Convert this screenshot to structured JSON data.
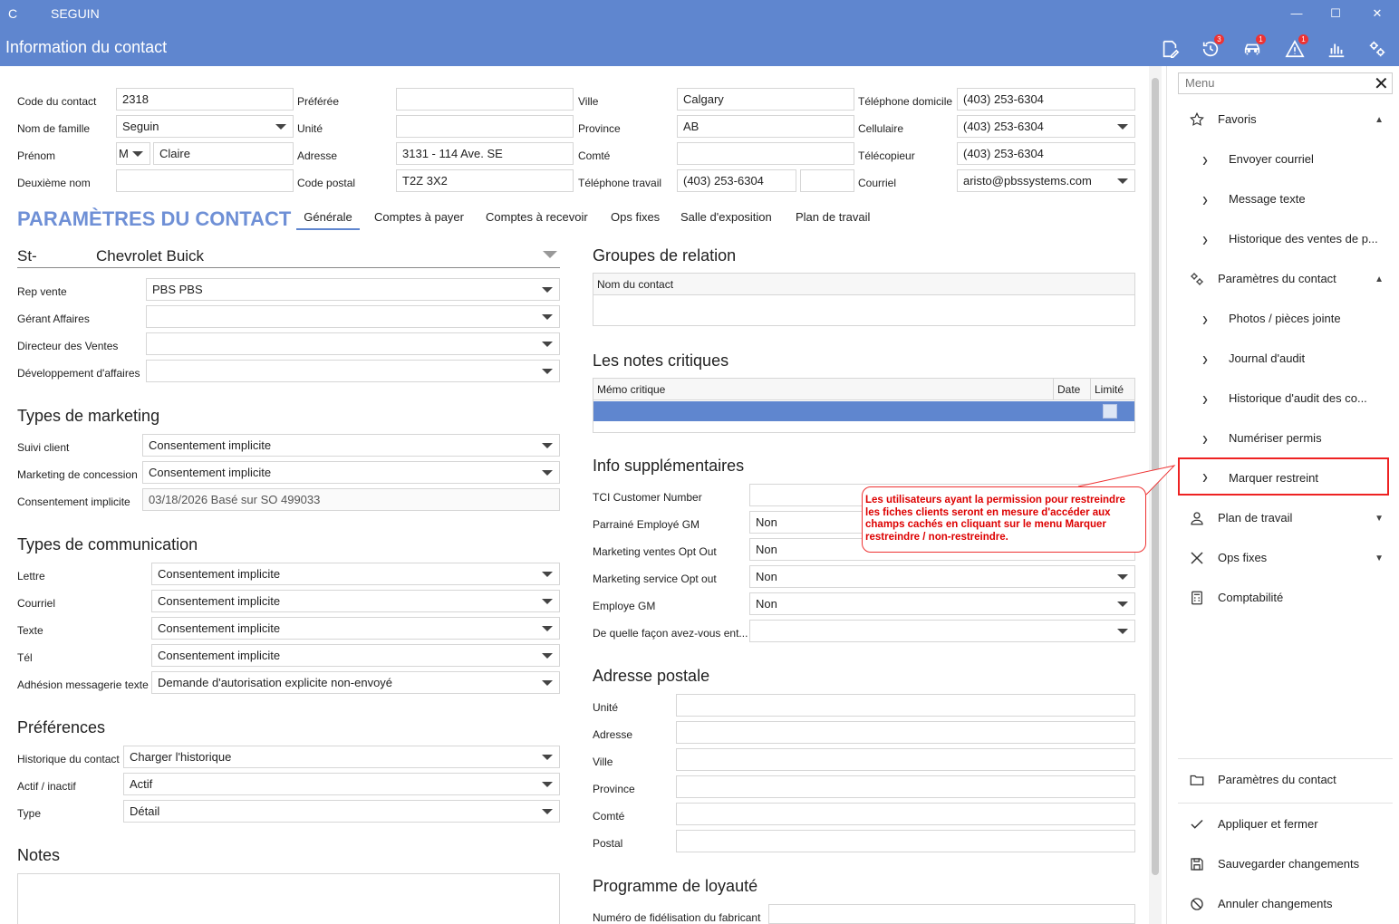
{
  "window": {
    "app_letter": "C",
    "title": "SEGUIN",
    "page_title": "Information du contact",
    "badges": {
      "history": "3",
      "car": "1",
      "alert": "1"
    },
    "controls": {
      "minimize": "—",
      "maximize": "☐",
      "close": "✕"
    }
  },
  "contact": {
    "code_label": "Code du contact",
    "code_value": "2318",
    "nom_label": "Nom de famille",
    "nom_value": "Seguin",
    "prenom_label": "Prénom",
    "prenom_title": "M",
    "prenom_value": "Claire",
    "deuxieme_label": "Deuxième nom",
    "deuxieme_value": "",
    "preferee_label": "Préférée",
    "preferee_value": "",
    "unite_label": "Unité",
    "unite_value": "",
    "adresse_label": "Adresse",
    "adresse_value": "3131 - 114 Ave. SE",
    "code_postal_label": "Code postal",
    "code_postal_value": "T2Z 3X2",
    "ville_label": "Ville",
    "ville_value": "Calgary",
    "province_label": "Province",
    "province_value": "AB",
    "comte_label": "Comté",
    "comte_value": "",
    "tel_travail_label": "Téléphone travail",
    "tel_travail_value": "(403) 253-6304",
    "tel_travail_ext": "",
    "tel_domicile_label": "Téléphone domicile",
    "tel_domicile_value": "(403) 253-6304",
    "cellulaire_label": "Cellulaire",
    "cellulaire_value": "(403) 253-6304",
    "telecopieur_label": "Télécopieur",
    "telecopieur_value": "(403) 253-6304",
    "courriel_label": "Courriel",
    "courriel_value": "aristo@pbssystems.com"
  },
  "params": {
    "title": "PARAMÈTRES DU CONTACT",
    "tabs": [
      "Générale",
      "Comptes à payer",
      "Comptes à recevoir",
      "Ops fixes",
      "Salle d'exposition",
      "Plan de travail"
    ]
  },
  "dealer": {
    "prefix": "St-",
    "name": "Chevrolet Buick",
    "rep_vente_label": "Rep vente",
    "rep_vente_value": "PBS PBS",
    "gerant_label": "Gérant Affaires",
    "gerant_value": "",
    "directeur_label": "Directeur des Ventes",
    "directeur_value": "",
    "developpement_label": "Développement d'affaires",
    "developpement_value": ""
  },
  "marketing": {
    "title": "Types de marketing",
    "suivi_label": "Suivi client",
    "suivi_value": "Consentement implicite",
    "concession_label": "Marketing de concession",
    "concession_value": "Consentement implicite",
    "implicite_label": "Consentement implicite",
    "implicite_value": "03/18/2026 Basé sur SO 499033"
  },
  "communication": {
    "title": "Types de communication",
    "lettre_label": "Lettre",
    "lettre_value": "Consentement implicite",
    "courriel_label": "Courriel",
    "courriel_value": "Consentement implicite",
    "texte_label": "Texte",
    "texte_value": "Consentement implicite",
    "tel_label": "Tél",
    "tel_value": "Consentement implicite",
    "adhesion_label": "Adhésion messagerie texte",
    "adhesion_value": "Demande d'autorisation explicite non-envoyé"
  },
  "preferences": {
    "title": "Préférences",
    "historique_label": "Historique du contact",
    "historique_value": "Charger l'historique",
    "actif_label": "Actif / inactif",
    "actif_value": "Actif",
    "type_label": "Type",
    "type_value": "Détail"
  },
  "notes": {
    "title": "Notes",
    "value": ""
  },
  "groupes": {
    "title": "Groupes de relation",
    "col": "Nom du contact"
  },
  "notes_critiques": {
    "title": "Les notes critiques",
    "col_memo": "Mémo critique",
    "col_date": "Date",
    "col_limite": "Limité"
  },
  "info_supp": {
    "title": "Info supplémentaires",
    "tci_label": "TCI Customer Number",
    "tci_value": "",
    "parraine_label": "Parrainé Employé GM",
    "parraine_value": "Non",
    "mkt_ventes_label": "Marketing ventes Opt Out",
    "mkt_ventes_value": "Non",
    "mkt_service_label": "Marketing service Opt out",
    "mkt_service_value": "Non",
    "employe_label": "Employe GM",
    "employe_value": "Non",
    "facon_label": "De quelle façon avez-vous ent...",
    "facon_value": ""
  },
  "adresse_postale": {
    "title": "Adresse postale",
    "unite_label": "Unité",
    "adresse_label": "Adresse",
    "ville_label": "Ville",
    "province_label": "Province",
    "comte_label": "Comté",
    "postal_label": "Postal"
  },
  "loyaute": {
    "title": "Programme de loyauté",
    "numero_label": "Numéro de fidélisation du fabricant",
    "numero_value": ""
  },
  "callout": {
    "text": "Les utilisateurs ayant la permission pour restreindre les fiches clients seront en mesure d'accéder aux champs cachés en cliquant sur le menu Marquer restreindre / non-restreindre."
  },
  "menu": {
    "search_placeholder": "Menu",
    "close": "✕",
    "favoris": "Favoris",
    "envoyer": "Envoyer courriel",
    "message": "Message texte",
    "historique_ventes": "Historique des ventes de p...",
    "params_contact": "Paramètres du contact",
    "photos": "Photos / pièces jointe",
    "journal": "Journal d'audit",
    "historique_audit": "Historique d'audit des co...",
    "numeriser": "Numériser permis",
    "marquer": "Marquer restreint",
    "plan": "Plan de travail",
    "ops": "Ops fixes",
    "comptabilite": "Comptabilité",
    "footer_params": "Paramètres du contact",
    "appliquer": "Appliquer et fermer",
    "sauvegarder": "Sauvegarder changements",
    "annuler": "Annuler changements"
  }
}
